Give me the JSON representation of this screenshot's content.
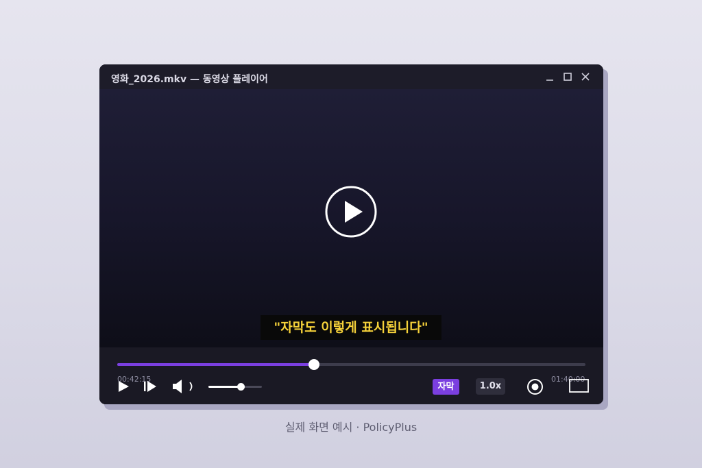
{
  "window": {
    "title": "영화_2026.mkv — 동영상 플레이어"
  },
  "video": {
    "subtitle": "\"자막도 이렇게 표시됩니다\""
  },
  "playback": {
    "current_time": "00:42:15",
    "total_time": "01:40:00",
    "progress_fraction": 0.42,
    "volume_fraction": 0.6
  },
  "controls": {
    "subtitle_label": "자막",
    "speed_label": "1.0x"
  },
  "icons": {
    "big_play": "play-circle-icon",
    "play": "play-icon",
    "next": "skip-next-icon",
    "volume": "volume-icon",
    "record": "record-icon",
    "fullscreen": "fullscreen-icon",
    "minimize": "minimize-icon",
    "maximize": "maximize-icon",
    "close": "close-icon"
  },
  "colors": {
    "accent": "#7b3fe0",
    "subtitle_text": "#f6d23a"
  },
  "caption": "실제 화면 예시 · PolicyPlus"
}
